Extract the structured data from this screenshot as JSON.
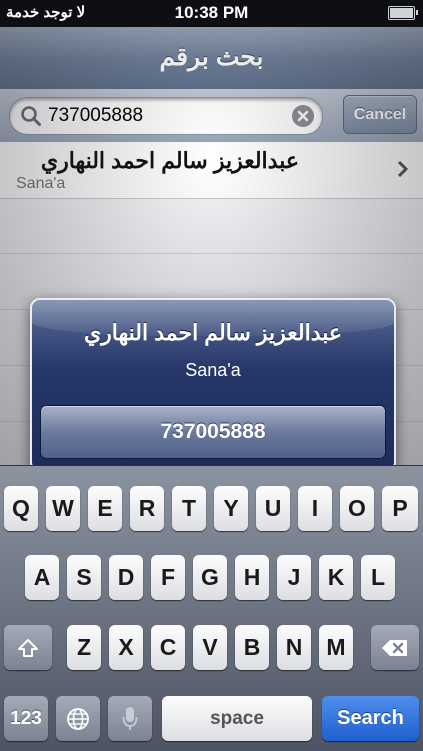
{
  "status_bar": {
    "carrier": "لا توجد خدمة",
    "time": "10:38 PM"
  },
  "navbar": {
    "title": "بحث برقم"
  },
  "search": {
    "value": "737005888",
    "cancel_label": "Cancel"
  },
  "results": [
    {
      "name": "عبدالعزيز سالم  احمد النهاري",
      "city": "Sana'a"
    }
  ],
  "alert": {
    "title": "عبدالعزيز سالم  احمد النهاري",
    "message": "Sana'a",
    "button": "737005888"
  },
  "keyboard": {
    "row1": [
      "Q",
      "W",
      "E",
      "R",
      "T",
      "Y",
      "U",
      "I",
      "O",
      "P"
    ],
    "row2": [
      "A",
      "S",
      "D",
      "F",
      "G",
      "H",
      "J",
      "K",
      "L"
    ],
    "row3": [
      "Z",
      "X",
      "C",
      "V",
      "B",
      "N",
      "M"
    ],
    "numbers_label": "123",
    "space_label": "space",
    "search_label": "Search",
    "icons": {
      "shift": "shift-arrow-icon",
      "delete": "backspace-icon",
      "globe": "globe-icon",
      "mic": "microphone-icon"
    }
  },
  "colors": {
    "search_key": "#2f70dd",
    "alert_bg": "#27376a",
    "nav_bg": "#6d7f98"
  }
}
